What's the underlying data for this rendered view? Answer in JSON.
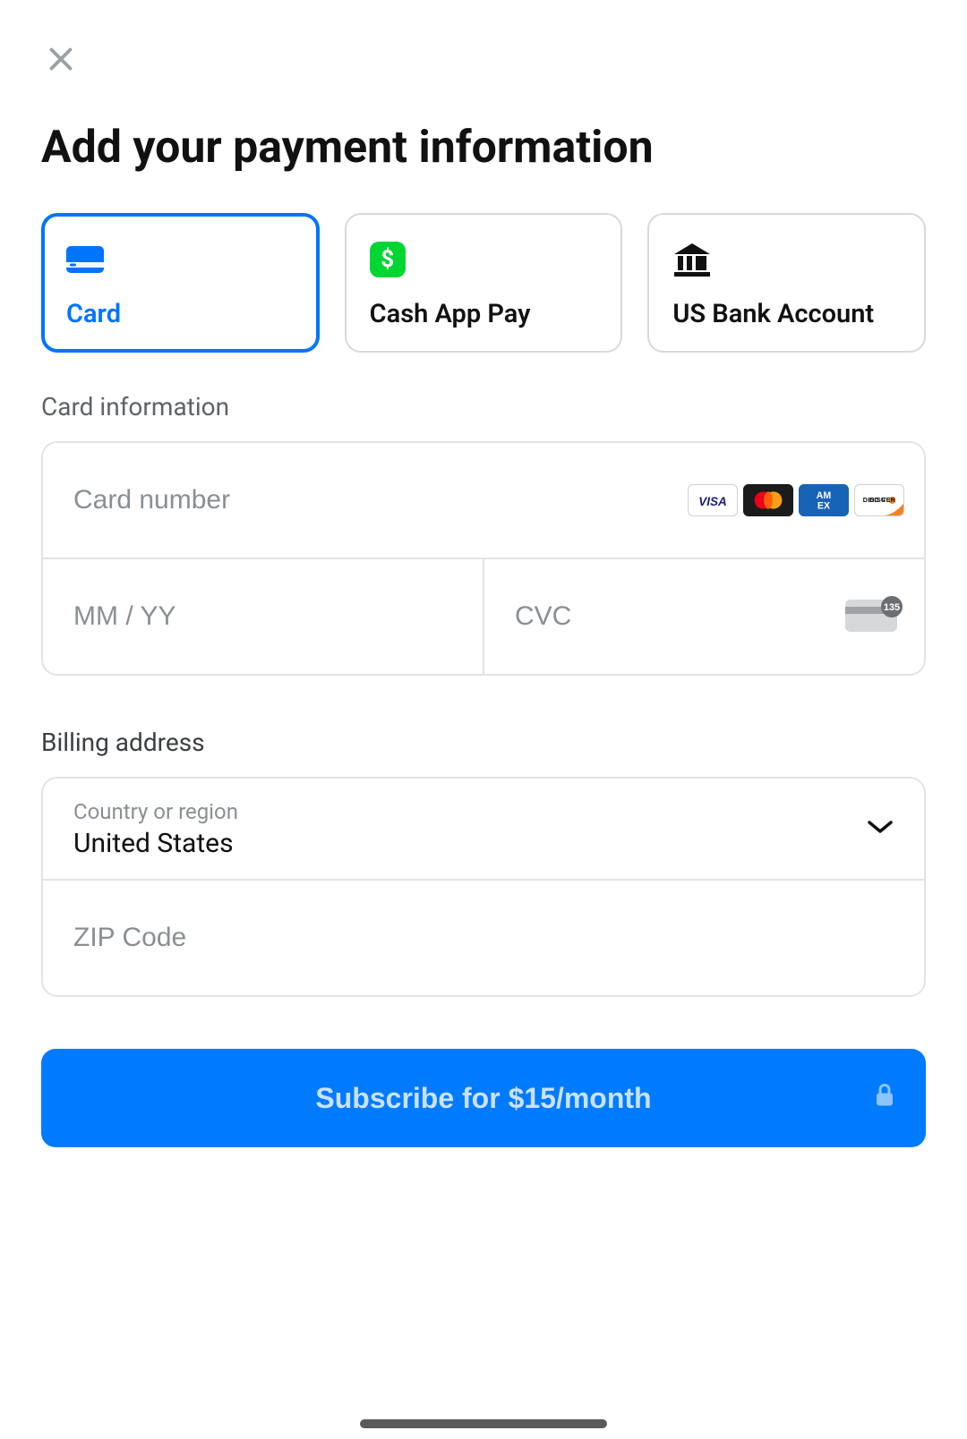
{
  "header": {
    "title": "Add your payment information"
  },
  "methods": {
    "card": "Card",
    "cashapp": "Cash App Pay",
    "bank": "US Bank Account"
  },
  "cardSection": {
    "label": "Card information",
    "numberPlaceholder": "Card number",
    "expiryPlaceholder": "MM / YY",
    "cvcPlaceholder": "CVC",
    "brands": [
      "visa",
      "mastercard",
      "amex",
      "discover"
    ],
    "cvcHint": "135"
  },
  "billing": {
    "label": "Billing address",
    "countryFloating": "Country or region",
    "countryValue": "United States",
    "zipPlaceholder": "ZIP Code"
  },
  "submit": {
    "label": "Subscribe for $15/month"
  }
}
